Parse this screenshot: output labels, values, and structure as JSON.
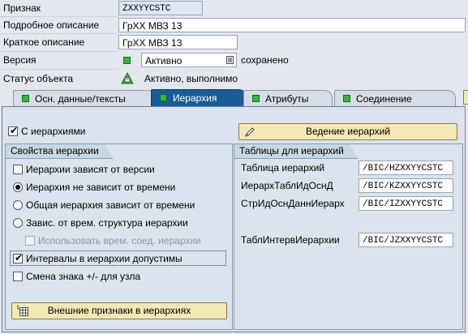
{
  "header": {
    "attribute_label": "Признак",
    "attribute_value": "ZXXYYCSTC",
    "long_desc_label": "Подробное описание",
    "long_desc_value": "ГрХХ МВЗ 13",
    "short_desc_label": "Краткое описание",
    "short_desc_value": "ГрХХ МВЗ 13",
    "version_label": "Версия",
    "version_value": "Активно",
    "version_saved": "сохранено",
    "status_label": "Статус объекта",
    "status_value": "Активно, выполнимо"
  },
  "tabs": [
    {
      "label": "Осн. данные/тексты",
      "active": false
    },
    {
      "label": "Иерархия",
      "active": true
    },
    {
      "label": "Атрибуты",
      "active": false
    },
    {
      "label": "Соединение",
      "active": false
    }
  ],
  "hierarchy": {
    "with_hierarchies_label": "С иерархиями",
    "with_hierarchies_checked": true,
    "maintain_button": "Ведение иерархий",
    "properties": {
      "title": "Свойства иерархии",
      "version_dependent": "Иерархии зависят от версии",
      "not_time_dependent": "Иерархия не зависит от времени",
      "entire_time_dependent": "Общая иерархия зависит от времени",
      "structure_time_dependent": "Завис. от врем. структура иерархии",
      "use_temp_join": "Использовать врем. соед. иерархии",
      "intervals_allowed": "Интервалы в иерархии допустимы",
      "sign_reversal": "Смена знака +/- для узла",
      "external_button": "Внешние признаки в иерархиях"
    },
    "tables": {
      "title": "Таблицы для иерархий",
      "rows": [
        {
          "label": "Таблица иерархий",
          "value": "/BIC/HZXXYYCSTC"
        },
        {
          "label": "ИерархТаблИдОснД",
          "value": "/BIC/KZXXYYCSTC"
        },
        {
          "label": "СтрИдОснДаннИерарх",
          "value": "/BIC/IZXXYYCSTC"
        },
        {
          "label": "ТаблИнтервИерархии",
          "value": "/BIC/JZXXYYCSTC"
        }
      ]
    }
  },
  "colors": {
    "active_tab": "#1b5c96",
    "status_green": "#2dbd2d",
    "button_bg": "#f4e8b4"
  }
}
